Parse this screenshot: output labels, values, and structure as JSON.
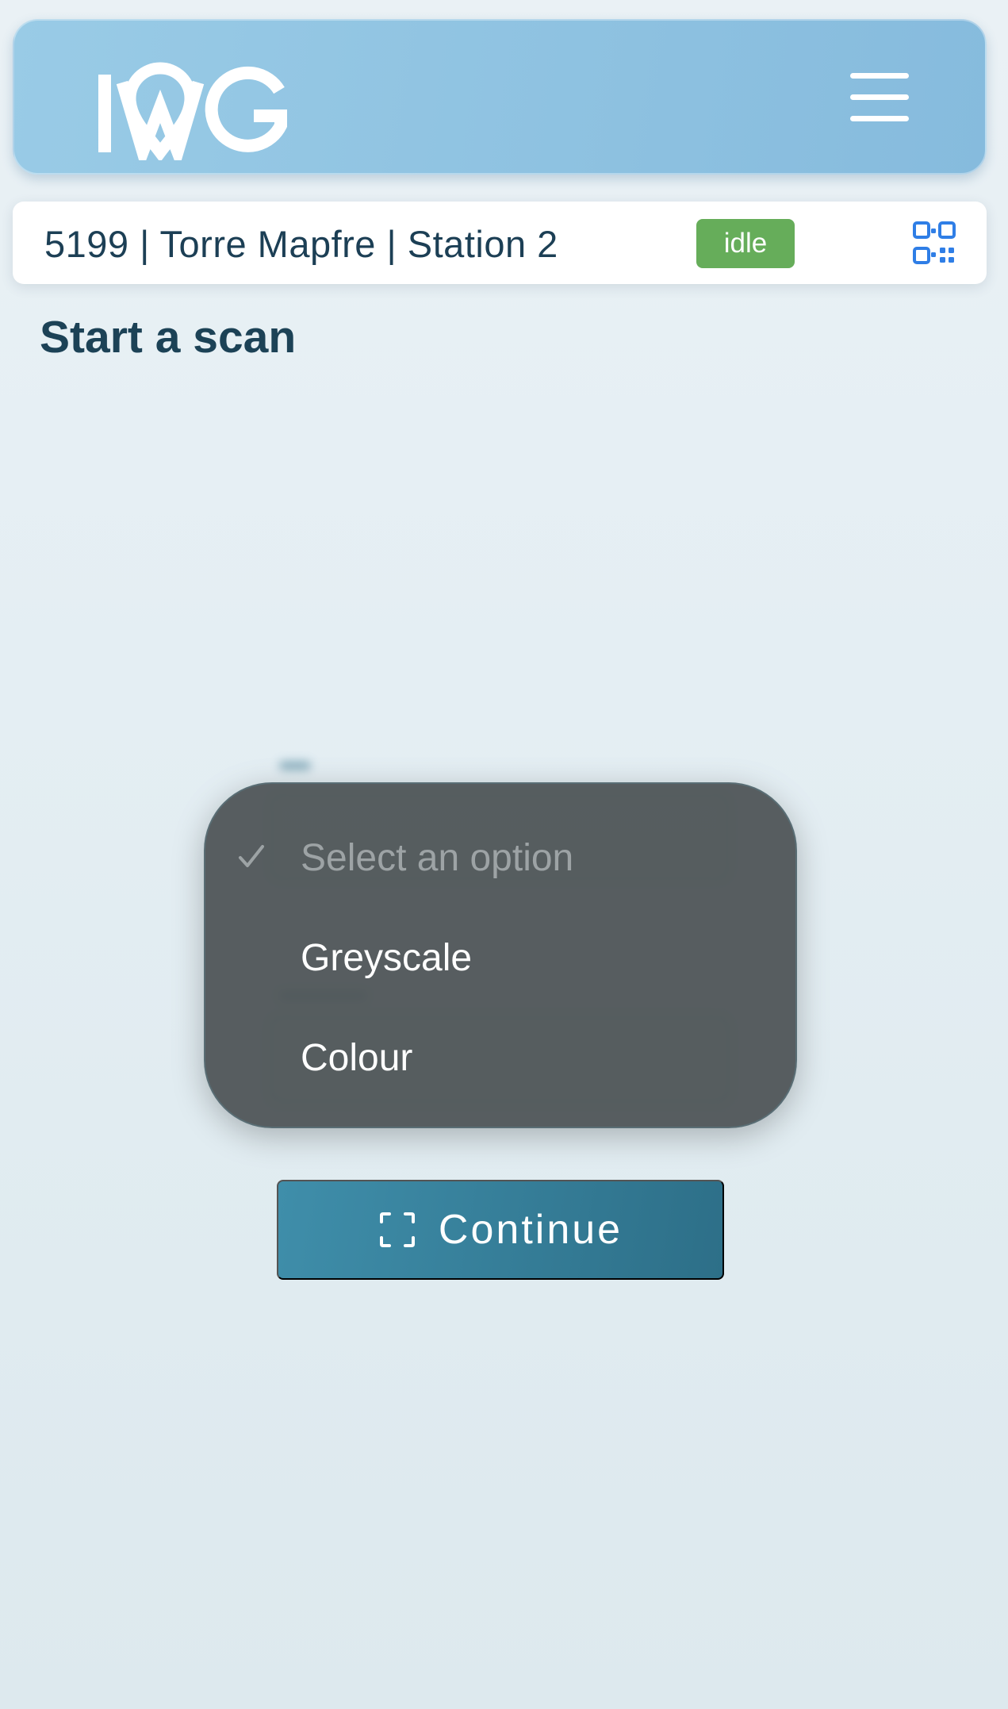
{
  "header": {
    "logo_text": "IWG",
    "logo_icon": "iwg-logo",
    "menu_icon": "hamburger-menu-icon"
  },
  "station": {
    "label": "5199 | Torre Mapfre | Station 2",
    "status": "idle",
    "status_color": "#66ad5a",
    "qr_icon": "qr-code-icon"
  },
  "page": {
    "title": "Start a scan"
  },
  "dropdown": {
    "options": [
      {
        "label": "Select an option",
        "selected": true
      },
      {
        "label": "Greyscale",
        "selected": false
      },
      {
        "label": "Colour",
        "selected": false
      }
    ]
  },
  "actions": {
    "continue_label": "Continue",
    "continue_icon": "scan-frame-icon"
  },
  "colors": {
    "header": "#8fc3e2",
    "primary_button": "#367e9a",
    "text_dark": "#1c3f55",
    "qr_icon": "#2f7ee6"
  }
}
